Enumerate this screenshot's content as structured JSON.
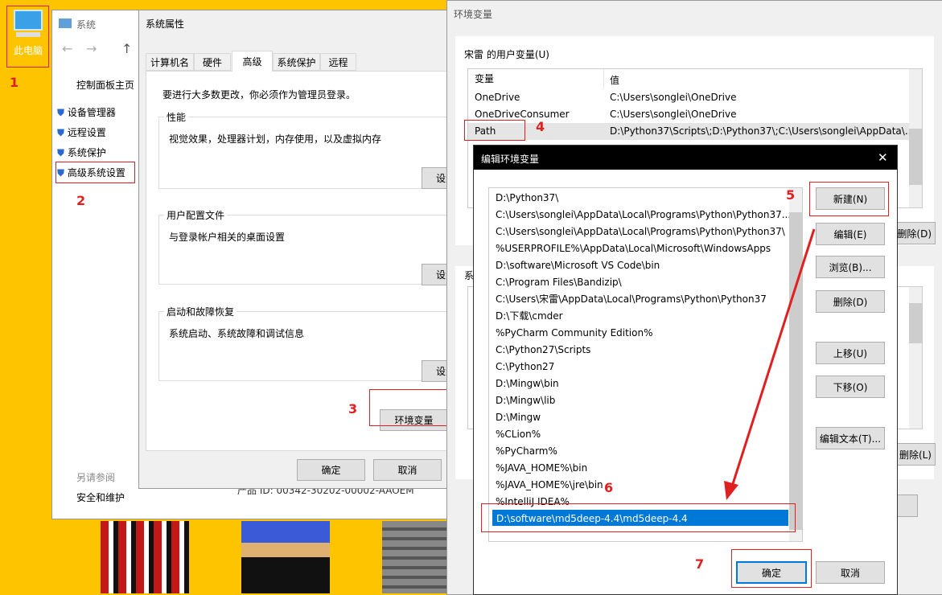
{
  "desktop": {
    "icon_label": "此电脑"
  },
  "annotations": [
    "1",
    "2",
    "3",
    "4",
    "5",
    "6",
    "7"
  ],
  "system": {
    "title": "系统",
    "sidebar_home": "控制面板主页",
    "items": [
      "设备管理器",
      "远程设置",
      "系统保护",
      "高级系统设置"
    ],
    "see_also": "另请参阅",
    "security": "安全和维护",
    "product_id": "产品 ID: 00342-30202-00002-AAOEM"
  },
  "sysprops": {
    "title": "系统属性",
    "tabs": [
      "计算机名",
      "硬件",
      "高级",
      "系统保护",
      "远程"
    ],
    "admin_note": "要进行大多数更改，你必须作为管理员登录。",
    "perf": {
      "label": "性能",
      "desc": "视觉效果，处理器计划，内存使用，以及虚拟内存",
      "button": "设置(S)..."
    },
    "profile": {
      "label": "用户配置文件",
      "desc": "与登录帐户相关的桌面设置",
      "button": "设置(E)..."
    },
    "startup": {
      "label": "启动和故障恢复",
      "desc": "系统启动、系统故障和调试信息",
      "button": "设置(T)..."
    },
    "env_button": "环境变量",
    "ok": "确定",
    "cancel": "取消"
  },
  "envvars": {
    "title": "环境变量",
    "user_label": "宋雷 的用户变量(U)",
    "col_var": "变量",
    "col_val": "值",
    "rows": [
      {
        "name": "OneDrive",
        "value": "C:\\Users\\songlei\\OneDrive"
      },
      {
        "name": "OneDriveConsumer",
        "value": "C:\\Users\\songlei\\OneDrive"
      },
      {
        "name": "Path",
        "value": "D:\\Python37\\Scripts\\;D:\\Python37\\;C:\\Users\\songlei\\AppData\\..."
      }
    ],
    "delete_btn": "删除(D)",
    "sys_label": "系统变量(S)",
    "sys_delete_btn": "删除(L)"
  },
  "edit": {
    "title": "编辑环境变量",
    "close": "✕",
    "items": [
      "D:\\Python37\\",
      "C:\\Users\\songlei\\AppData\\Local\\Programs\\Python\\Python37...",
      "C:\\Users\\songlei\\AppData\\Local\\Programs\\Python\\Python37\\",
      "%USERPROFILE%\\AppData\\Local\\Microsoft\\WindowsApps",
      "D:\\software\\Microsoft VS Code\\bin",
      "C:\\Program Files\\Bandizip\\",
      "C:\\Users\\宋雷\\AppData\\Local\\Programs\\Python\\Python37",
      "D:\\下载\\cmder",
      "%PyCharm Community Edition%",
      "C:\\Python27\\Scripts",
      "C:\\Python27",
      "D:\\Mingw\\bin",
      "D:\\Mingw\\lib",
      "D:\\Mingw",
      "%CLion%",
      "%PyCharm%",
      "%JAVA_HOME%\\bin",
      "%JAVA_HOME%\\jre\\bin",
      "%IntelliJ IDEA%"
    ],
    "editing_value": "D:\\software\\md5deep-4.4\\md5deep-4.4",
    "buttons": [
      "新建(N)",
      "编辑(E)",
      "浏览(B)...",
      "删除(D)",
      "上移(U)",
      "下移(O)",
      "编辑文本(T)..."
    ],
    "ok": "确定",
    "cancel": "取消"
  },
  "colors": {
    "desktop": "#ffc400",
    "selection": "#0078d7",
    "annotation": "#e02020"
  }
}
